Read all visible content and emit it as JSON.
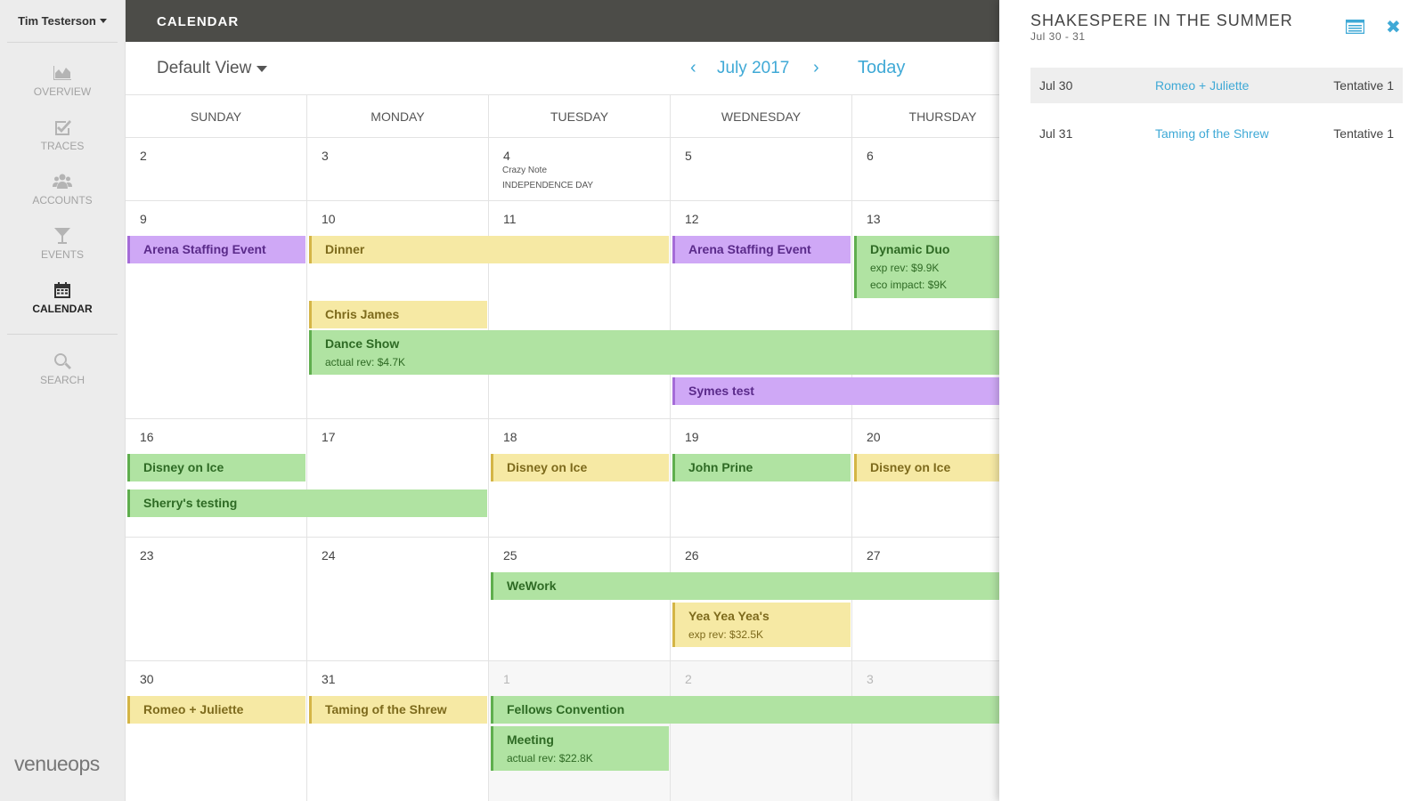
{
  "sidebar": {
    "user": "Tim Testerson",
    "nav": [
      {
        "label": "OVERVIEW",
        "icon": "area-chart-icon"
      },
      {
        "label": "TRACES",
        "icon": "checkbox-icon"
      },
      {
        "label": "ACCOUNTS",
        "icon": "users-icon"
      },
      {
        "label": "EVENTS",
        "icon": "cocktail-icon"
      },
      {
        "label": "CALENDAR",
        "icon": "calendar-icon"
      },
      {
        "label": "SEARCH",
        "icon": "search-icon"
      }
    ],
    "brand": "venueops"
  },
  "topbar": {
    "title": "CALENDAR"
  },
  "toolbar": {
    "view": "Default View",
    "prev": "‹",
    "month": "July 2017",
    "next": "›",
    "today": "Today"
  },
  "calendar": {
    "days_of_week": [
      "SUNDAY",
      "MONDAY",
      "TUESDAY",
      "WEDNESDAY",
      "THURSDAY"
    ],
    "weeks": [
      {
        "days": [
          "2",
          "3",
          "4",
          "5",
          "6"
        ]
      },
      {
        "days": [
          "9",
          "10",
          "11",
          "12",
          "13"
        ]
      },
      {
        "days": [
          "16",
          "17",
          "18",
          "19",
          "20"
        ]
      },
      {
        "days": [
          "23",
          "24",
          "25",
          "26",
          "27"
        ]
      },
      {
        "days": [
          "30",
          "31",
          "1",
          "2",
          "3"
        ]
      }
    ],
    "notes": {
      "crazy_note": "Crazy Note",
      "holiday": "INDEPENDENCE DAY"
    },
    "events": [
      {
        "name": "Arena Staffing Event",
        "color": "#cfa8f6"
      },
      {
        "name": "Dinner",
        "color": "#f6e9a4"
      },
      {
        "name": "Arena Staffing Event",
        "color": "#cfa8f6"
      },
      {
        "name": "Dynamic Duo",
        "sub1": "exp rev: $9.9K",
        "sub2": "eco impact: $9K",
        "color": "#b0e3a2"
      },
      {
        "name": "Chris James",
        "color": "#f6e9a4"
      },
      {
        "name": "Dance Show",
        "sub1": "actual rev: $4.7K",
        "color": "#b0e3a2"
      },
      {
        "name": "Symes test",
        "color": "#cfa8f6"
      },
      {
        "name": "Disney on Ice",
        "color": "#b0e3a2"
      },
      {
        "name": "Disney on Ice",
        "color": "#f6e9a4"
      },
      {
        "name": "John Prine",
        "color": "#b0e3a2"
      },
      {
        "name": "Disney on Ice",
        "color": "#f6e9a4"
      },
      {
        "name": "Sherry's testing",
        "color": "#b0e3a2"
      },
      {
        "name": "WeWork",
        "color": "#b0e3a2"
      },
      {
        "name": "Yea Yea Yea's",
        "sub1": "exp rev: $32.5K",
        "color": "#f6e9a4"
      },
      {
        "name": "Romeo + Juliette",
        "color": "#f6e9a4"
      },
      {
        "name": "Taming of the Shrew",
        "color": "#f6e9a4"
      },
      {
        "name": "Fellows Convention",
        "color": "#b0e3a2"
      },
      {
        "name": "Meeting",
        "sub1": "actual rev: $22.8K",
        "color": "#b0e3a2"
      }
    ]
  },
  "panel": {
    "title": "SHAKESPERE IN THE SUMMER",
    "dates": "Jul 30 - 31",
    "close": "✖",
    "rows": [
      {
        "date": "Jul 30",
        "name": "Romeo + Juliette",
        "status": "Tentative 1"
      },
      {
        "date": "Jul 31",
        "name": "Taming of the Shrew",
        "status": "Tentative 1"
      }
    ]
  },
  "colors": {
    "accent": "#3fa9d6",
    "topbar": "#4c4c48",
    "sidebar": "#ececec",
    "event_green": "#b0e3a2",
    "event_yellow": "#f6e9a4",
    "event_purple": "#cfa8f6"
  }
}
